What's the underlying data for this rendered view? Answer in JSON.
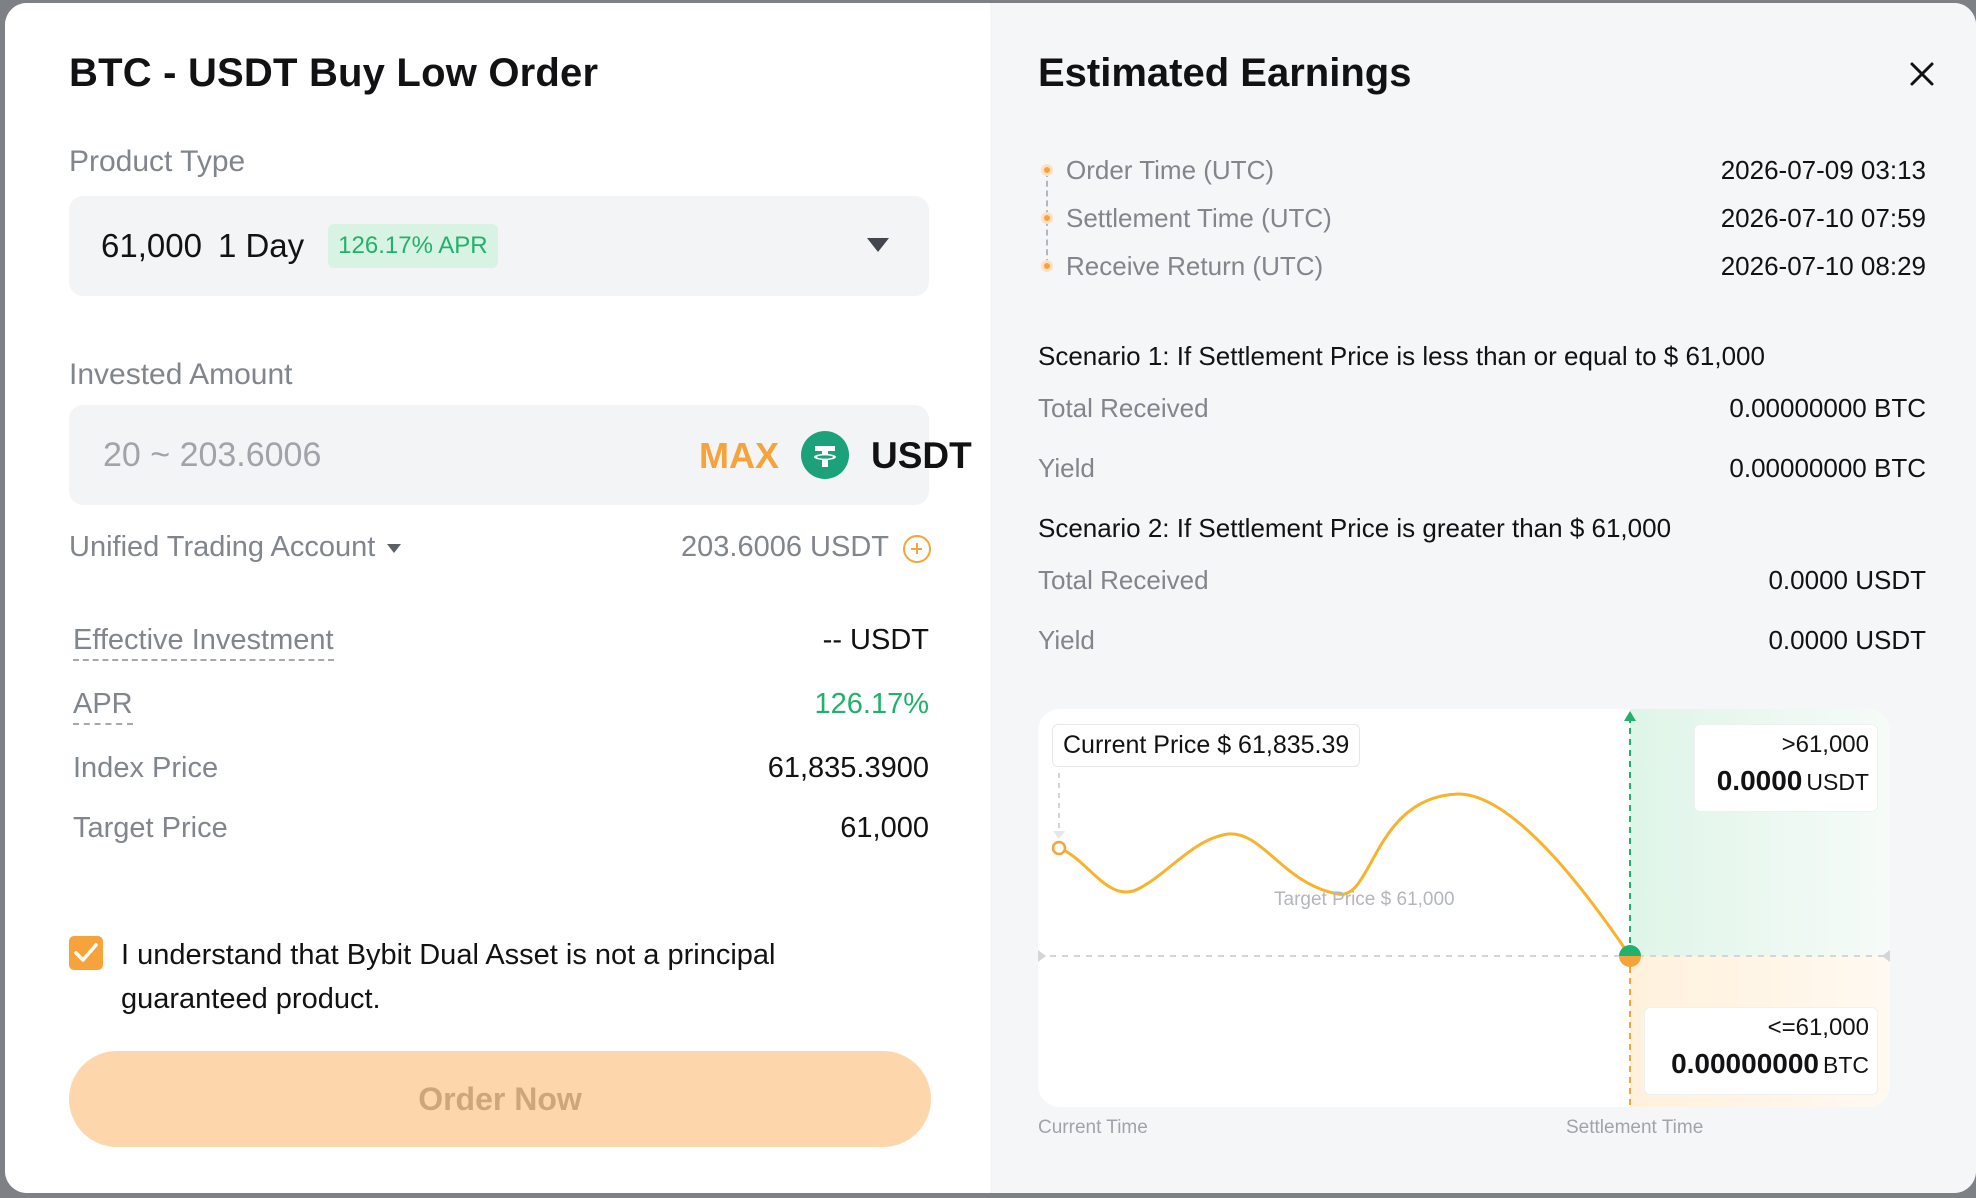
{
  "order": {
    "title": "BTC - USDT Buy Low Order",
    "product_type_label": "Product Type",
    "product": {
      "strike": "61,000",
      "duration": "1 Day",
      "apr_chip": "126.17% APR"
    },
    "invested_label": "Invested Amount",
    "amount_placeholder": "20 ~ 203.6006",
    "max_label": "MAX",
    "currency": "USDT",
    "account": "Unified Trading Account",
    "balance": "203.6006 USDT",
    "details": [
      {
        "label": "Effective Investment",
        "value": "-- USDT"
      },
      {
        "label": "APR",
        "value": "126.17%"
      },
      {
        "label": "Index Price",
        "value": "61,835.3900"
      },
      {
        "label": "Target Price",
        "value": "61,000"
      }
    ],
    "agreement": "I understand that Bybit Dual Asset is not a principal guaranteed product.",
    "agreement_checked": true,
    "order_button": "Order Now"
  },
  "earnings": {
    "title": "Estimated Earnings",
    "timeline": [
      {
        "label": "Order Time (UTC)",
        "value": "2026-07-09 03:13"
      },
      {
        "label": "Settlement Time (UTC)",
        "value": "2026-07-10 07:59"
      },
      {
        "label": "Receive Return (UTC)",
        "value": "2026-07-10 08:29"
      }
    ],
    "scenario1": {
      "title": "Scenario 1: If Settlement Price is less than or equal to $ 61,000",
      "total_label": "Total Received",
      "total_value": "0.00000000 BTC",
      "yield_label": "Yield",
      "yield_value": "0.00000000 BTC"
    },
    "scenario2": {
      "title": "Scenario 2: If Settlement Price is greater than $ 61,000",
      "total_label": "Total Received",
      "total_value": "0.0000 USDT",
      "yield_label": "Yield",
      "yield_value": "0.0000 USDT"
    },
    "chart": {
      "current_price": "Current Price $ 61,835.39",
      "target_price": "Target Price $ 61,000",
      "high": {
        "label": ">61,000",
        "amount": "0.0000",
        "unit": "USDT"
      },
      "low": {
        "label": "<=61,000",
        "amount": "0.00000000",
        "unit": "BTC"
      },
      "x_start": "Current Time",
      "x_end": "Settlement Time"
    }
  },
  "colors": {
    "accent": "#f7a33b",
    "positive": "#20b26c",
    "button_disabled": "#fed6ab"
  }
}
